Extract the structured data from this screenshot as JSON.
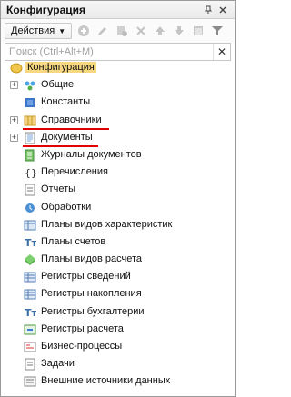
{
  "window": {
    "title": "Конфигурация",
    "pin_icon": "pin-icon",
    "close_icon": "close-icon"
  },
  "toolbar": {
    "actions_label": "Действия",
    "tools": [
      "add-icon",
      "edit-icon",
      "copy-icon",
      "delete-icon",
      "move-up-icon",
      "move-down-icon",
      "panel-icon",
      "filter-icon"
    ]
  },
  "search": {
    "placeholder": "Поиск (Ctrl+Alt+M)",
    "value": ""
  },
  "tree": {
    "root": {
      "label": "Конфигурация"
    },
    "items": [
      {
        "label": "Общие",
        "expandable": true
      },
      {
        "label": "Константы",
        "expandable": false
      },
      {
        "label": "Справочники",
        "expandable": true,
        "underlined": true
      },
      {
        "label": "Документы",
        "expandable": true,
        "underlined": true
      },
      {
        "label": "Журналы документов",
        "expandable": false
      },
      {
        "label": "Перечисления",
        "expandable": false
      },
      {
        "label": "Отчеты",
        "expandable": false
      },
      {
        "label": "Обработки",
        "expandable": false
      },
      {
        "label": "Планы видов характеристик",
        "expandable": false
      },
      {
        "label": "Планы счетов",
        "expandable": false
      },
      {
        "label": "Планы видов расчета",
        "expandable": false
      },
      {
        "label": "Регистры сведений",
        "expandable": false
      },
      {
        "label": "Регистры накопления",
        "expandable": false
      },
      {
        "label": "Регистры бухгалтерии",
        "expandable": false
      },
      {
        "label": "Регистры расчета",
        "expandable": false
      },
      {
        "label": "Бизнес-процессы",
        "expandable": false
      },
      {
        "label": "Задачи",
        "expandable": false
      },
      {
        "label": "Внешние источники данных",
        "expandable": false
      }
    ]
  },
  "colors": {
    "selection": "#f7d77f",
    "underline": "#e00000"
  }
}
